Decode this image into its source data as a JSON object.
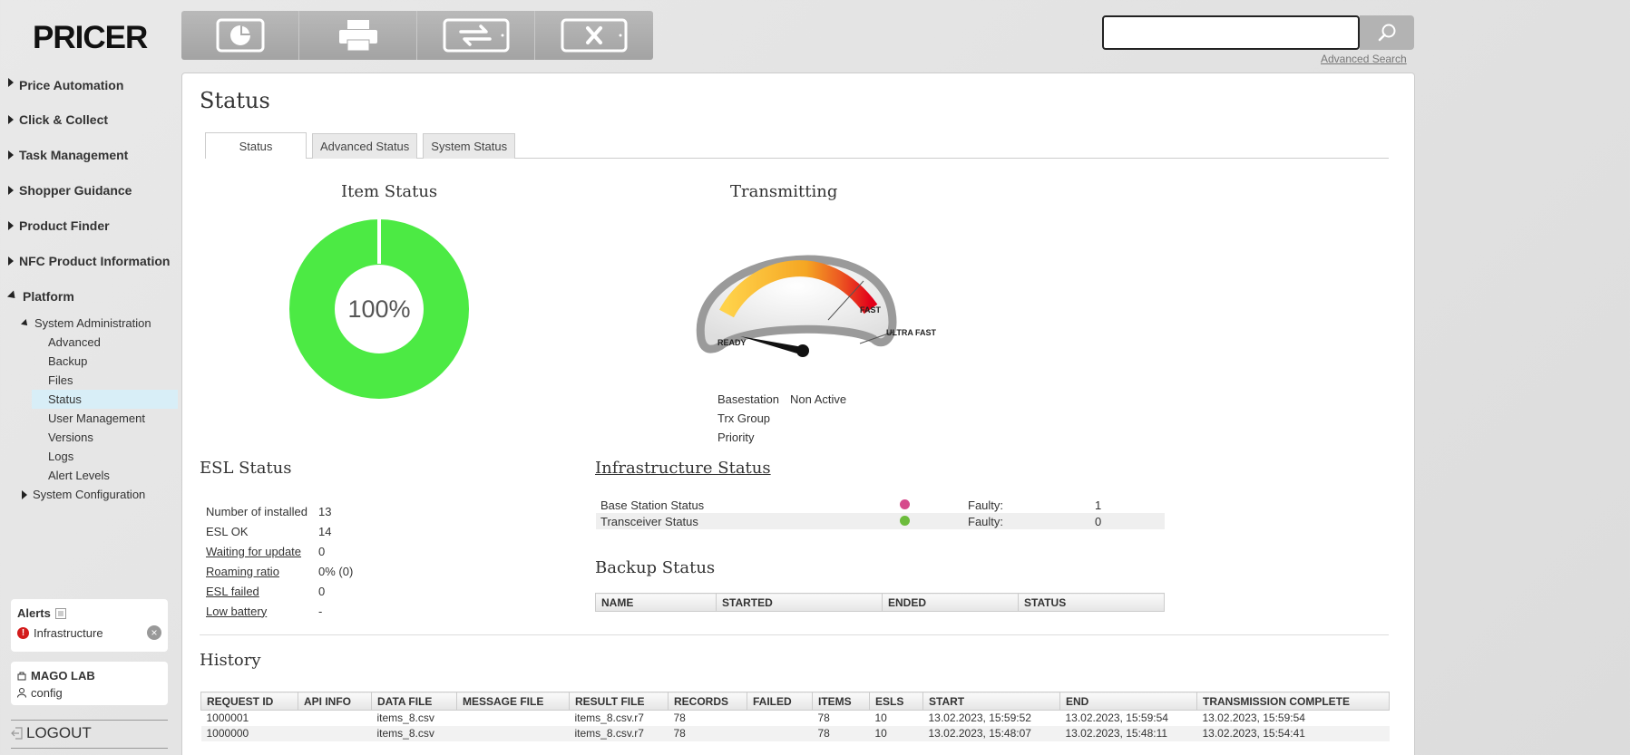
{
  "brand": {
    "logo": "PRICER"
  },
  "toolbar": {
    "buttons": [
      {
        "name": "dashboard-button",
        "icon": "pie-chart-icon"
      },
      {
        "name": "print-button",
        "icon": "printer-icon"
      },
      {
        "name": "link-esl-button",
        "icon": "swap-arrows-icon"
      },
      {
        "name": "unlink-esl-button",
        "icon": "x-icon"
      }
    ]
  },
  "search": {
    "value": "",
    "placeholder": "",
    "advanced_label": "Advanced Search"
  },
  "sidebar": {
    "top_items": [
      "Price Automation",
      "Click & Collect",
      "Task Management",
      "Shopper Guidance",
      "Product Finder",
      "NFC Product Information",
      "Platform"
    ],
    "system_admin": "System Administration",
    "admin_items": [
      "Advanced",
      "Backup",
      "Files",
      "Status",
      "User Management",
      "Versions",
      "Logs",
      "Alert Levels"
    ],
    "active_item": "Status",
    "system_config": "System Configuration"
  },
  "alerts": {
    "title": "Alerts",
    "items": [
      "Infrastructure"
    ]
  },
  "user": {
    "store": "MAGO LAB",
    "name": "config"
  },
  "logout": "LOGOUT",
  "page": {
    "title": "Status",
    "tabs": [
      "Status",
      "Advanced Status",
      "System Status"
    ]
  },
  "item_status": {
    "title": "Item Status",
    "percent": 100,
    "label": "100%",
    "color": "#4cea44"
  },
  "transmitting": {
    "title": "Transmitting",
    "labels": {
      "ready": "READY",
      "fast": "FAST",
      "ultra_fast": "ULTRA FAST"
    },
    "basestation_label": "Basestation",
    "basestation_value": "Non Active",
    "trx_label": "Trx Group",
    "priority_label": "Priority"
  },
  "esl_status": {
    "title": "ESL Status",
    "rows": [
      {
        "label": "Number of installed",
        "value": "13"
      },
      {
        "label": "ESL OK",
        "value": "14"
      },
      {
        "label": "Waiting for update",
        "value": "0"
      },
      {
        "label": "Roaming ratio",
        "value": "0% (0)"
      },
      {
        "label": "ESL failed",
        "value": "0"
      },
      {
        "label": "Low battery",
        "value": "-"
      }
    ]
  },
  "infrastructure": {
    "title": "Infrastructure Status",
    "rows": [
      {
        "label": "Base Station Status",
        "status_color": "#d64a8c",
        "faulty_label": "Faulty:",
        "faulty": "1"
      },
      {
        "label": "Transceiver Status",
        "status_color": "#6cbc3c",
        "faulty_label": "Faulty:",
        "faulty": "0"
      }
    ]
  },
  "backup": {
    "title": "Backup Status",
    "columns": [
      "NAME",
      "STARTED",
      "ENDED",
      "STATUS"
    ]
  },
  "history": {
    "title": "History",
    "columns": [
      "REQUEST ID",
      "API INFO",
      "DATA FILE",
      "MESSAGE FILE",
      "RESULT FILE",
      "RECORDS",
      "FAILED",
      "ITEMS",
      "ESLS",
      "START",
      "END",
      "TRANSMISSION COMPLETE"
    ],
    "rows": [
      [
        "1000001",
        "",
        "items_8.csv",
        "",
        "items_8.csv.r7",
        "78",
        "",
        "78",
        "10",
        "13.02.2023, 15:59:52",
        "13.02.2023, 15:59:54",
        "13.02.2023, 15:59:54"
      ],
      [
        "1000000",
        "",
        "items_8.csv",
        "",
        "items_8.csv.r7",
        "78",
        "",
        "78",
        "10",
        "13.02.2023, 15:48:07",
        "13.02.2023, 15:48:11",
        "13.02.2023, 15:54:41"
      ]
    ]
  }
}
